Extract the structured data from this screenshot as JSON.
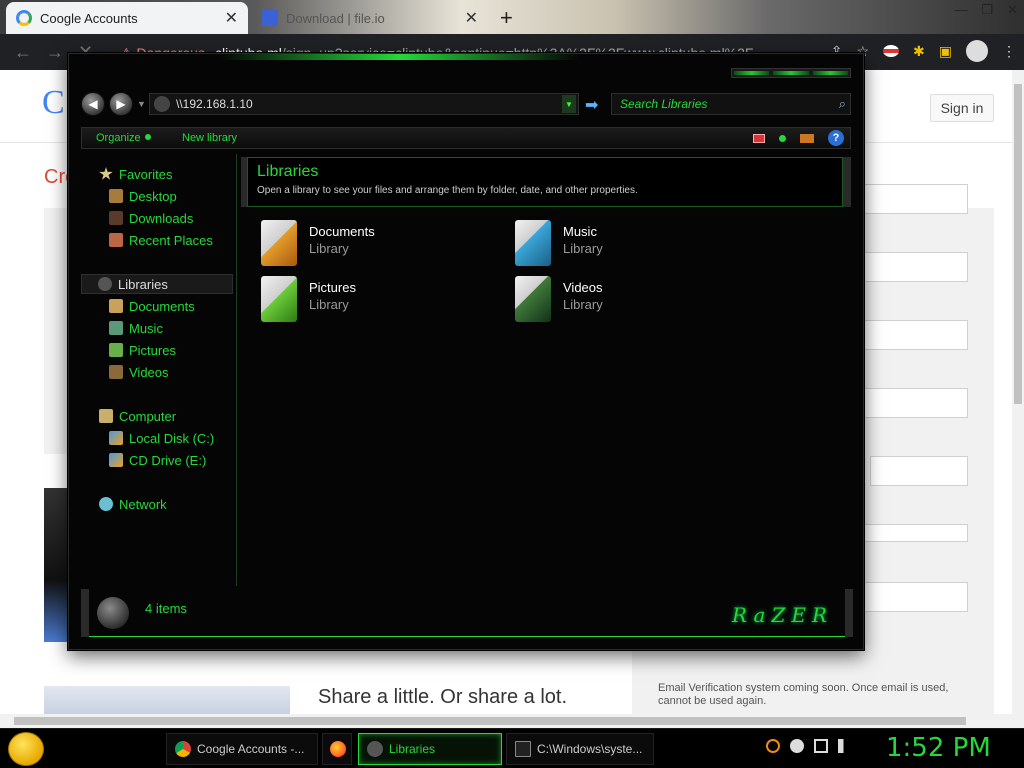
{
  "browser": {
    "tabs": [
      {
        "title": "Coogle Accounts",
        "icon": "google-icon"
      },
      {
        "title": "Download | file.io",
        "icon": "file-io-icon"
      }
    ],
    "address": {
      "warning": "Dangerous",
      "host": "cliptube.ml",
      "path": "/sign_up?service=cliptube&continue=http%3A%2F%2Fwww.cliptube.ml%2F..."
    }
  },
  "page": {
    "logo": "C",
    "sign_in": "Sign in",
    "heading": "Cre",
    "share_text": "Share a little. Or share a lot.",
    "email_note": "Email Verification system coming soon. Once email is used, cannot be used again."
  },
  "explorer": {
    "address": "\\\\192.168.1.10",
    "search_placeholder": "Search Libraries",
    "commands": {
      "organize": "Organize",
      "new_library": "New library"
    },
    "nav": {
      "favorites": "Favorites",
      "desktop": "Desktop",
      "downloads": "Downloads",
      "recent": "Recent Places",
      "libraries": "Libraries",
      "documents": "Documents",
      "music": "Music",
      "pictures": "Pictures",
      "videos": "Videos",
      "computer": "Computer",
      "local_disk": "Local Disk (C:)",
      "cd_drive": "CD Drive (E:)",
      "network": "Network"
    },
    "header": {
      "title": "Libraries",
      "description": "Open a library to see your files and arrange them by folder, date, and other properties."
    },
    "libraries": [
      {
        "name": "Documents",
        "type": "Library",
        "icon": "documents-library-icon"
      },
      {
        "name": "Music",
        "type": "Library",
        "icon": "music-library-icon"
      },
      {
        "name": "Pictures",
        "type": "Library",
        "icon": "pictures-library-icon"
      },
      {
        "name": "Videos",
        "type": "Library",
        "icon": "videos-library-icon"
      }
    ],
    "status": {
      "count": "4 items",
      "brand": "RaZER"
    }
  },
  "taskbar": {
    "tasks": [
      {
        "label": "Coogle Accounts -...",
        "icon": "chrome-icon"
      },
      {
        "label": "",
        "icon": "firefox-icon"
      },
      {
        "label": "Libraries",
        "icon": "libraries-icon"
      },
      {
        "label": "C:\\Windows\\syste...",
        "icon": "cmd-icon"
      }
    ],
    "clock": "1:52 PM"
  },
  "colors": {
    "accent": "#25d93a",
    "window_bg": "#050505",
    "taskbar_bg": "#000000"
  }
}
